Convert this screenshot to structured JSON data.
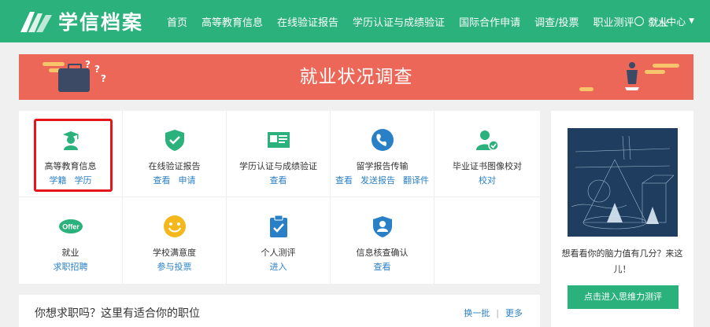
{
  "brand": {
    "name": "学信档案"
  },
  "nav": {
    "items": [
      "首页",
      "高等教育信息",
      "在线验证报告",
      "学历认证与成绩验证",
      "国际合作申请",
      "调查/投票",
      "职业测评",
      "就业"
    ],
    "user_label": "个人中心"
  },
  "banner": {
    "title": "就业状况调查"
  },
  "services": [
    {
      "title": "高等教育信息",
      "links": [
        "学籍",
        "学历"
      ],
      "icon": "graduate-icon"
    },
    {
      "title": "在线验证报告",
      "links": [
        "查看",
        "申请"
      ],
      "icon": "shield-check-icon"
    },
    {
      "title": "学历认证与成绩验证",
      "links": [
        "查看"
      ],
      "icon": "certificate-icon"
    },
    {
      "title": "留学报告传输",
      "links": [
        "查看",
        "发送报告",
        "翻译件"
      ],
      "icon": "globe-icon"
    },
    {
      "title": "毕业证书图像校对",
      "links": [
        "校对"
      ],
      "icon": "user-check-icon"
    },
    {
      "title": "就业",
      "links": [
        "求职招聘"
      ],
      "icon": "offer-icon"
    },
    {
      "title": "学校满意度",
      "links": [
        "参与投票"
      ],
      "icon": "smiley-icon"
    },
    {
      "title": "个人测评",
      "links": [
        "进入"
      ],
      "icon": "clipboard-check-icon"
    },
    {
      "title": "信息核查确认",
      "links": [
        "查看"
      ],
      "icon": "shield-user-icon"
    }
  ],
  "offer_badge": "Offer",
  "jobs": {
    "title": "你想求职吗？这里有适合你的职位",
    "refresh": "换一批",
    "more": "更多"
  },
  "ad": {
    "caption": "想看看你的脑力值有几分？来这儿！",
    "button": "点击进入思维力测评"
  },
  "colors": {
    "brand_green": "#2ab17c",
    "banner_red": "#ec6757",
    "link_blue": "#2a80c7",
    "highlight_red": "#e5161a"
  }
}
